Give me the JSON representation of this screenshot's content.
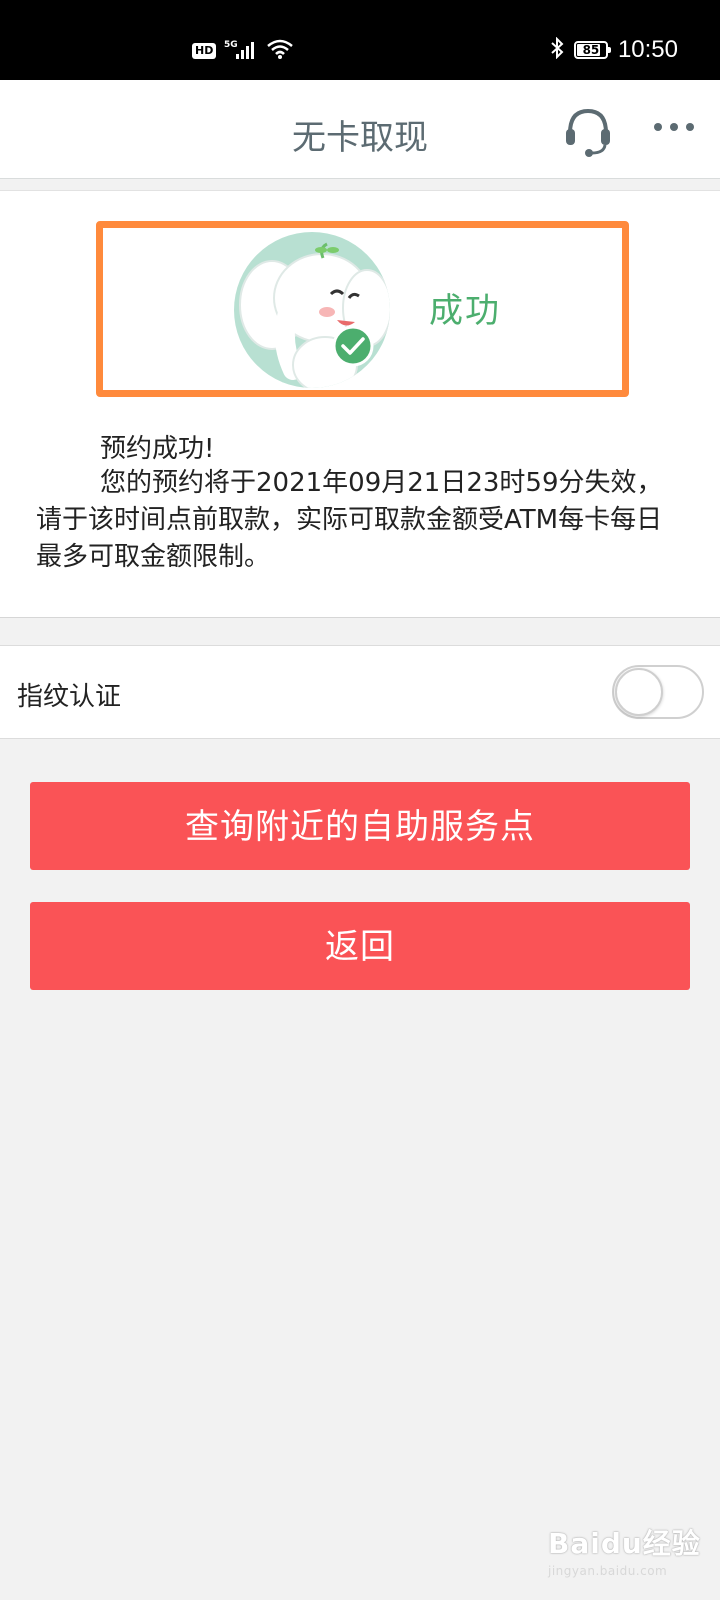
{
  "status_bar": {
    "hd_badge": "HD",
    "network": "5G",
    "battery_level": 85,
    "battery_text": "85",
    "time": "10:50"
  },
  "header": {
    "title": "无卡取现",
    "icons": [
      "headset-icon",
      "more-icon"
    ]
  },
  "result": {
    "status_label": "成功",
    "message_title": "预约成功!",
    "message_body": "您的预约将于2021年09月21日23时59分失效，请于该时间点前取款，实际可取款金额受ATM每卡每日最多可取金额限制。",
    "frame_color": "#ff8a3c",
    "success_color": "#4cae6e"
  },
  "fingerprint": {
    "label": "指纹认证",
    "enabled": false
  },
  "buttons": {
    "nearby_label": "查询附近的自助服务点",
    "back_label": "返回",
    "color": "#fa5356"
  },
  "watermark": {
    "main": "Baidu经验",
    "sub": "jingyan.baidu.com"
  }
}
